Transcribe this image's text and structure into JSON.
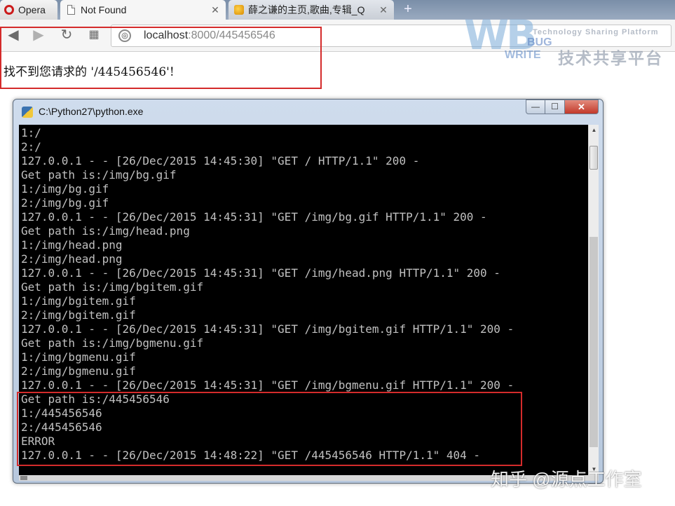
{
  "browser": {
    "tabs": [
      {
        "label": "Opera"
      },
      {
        "label": "Not Found",
        "close": "✕"
      },
      {
        "label": "薛之谦的主页,歌曲,专辑_Q",
        "close": "✕"
      }
    ],
    "new_tab": "+",
    "toolbar": {
      "back": "◀",
      "forward": "▶",
      "reload": "↻",
      "speed_dial": "▦"
    },
    "address": {
      "host": "localhost",
      "rest": ":8000/445456546",
      "site_icon": "globe-icon"
    }
  },
  "page": {
    "message": "找不到您请求的 '/445456546'!"
  },
  "watermark": {
    "logo": "WB",
    "bug": "BUG",
    "write": "WRITE",
    "subtitle": "Technology Sharing Platform",
    "chinese": "技术共享平台"
  },
  "console": {
    "title": "C:\\Python27\\python.exe",
    "controls": {
      "minimize": "—",
      "maximize": "☐",
      "close": "✕"
    },
    "lines": [
      "1:/",
      "2:/",
      "127.0.0.1 - - [26/Dec/2015 14:45:30] \"GET / HTTP/1.1\" 200 -",
      "Get path is:/img/bg.gif",
      "1:/img/bg.gif",
      "2:/img/bg.gif",
      "127.0.0.1 - - [26/Dec/2015 14:45:31] \"GET /img/bg.gif HTTP/1.1\" 200 -",
      "Get path is:/img/head.png",
      "1:/img/head.png",
      "2:/img/head.png",
      "127.0.0.1 - - [26/Dec/2015 14:45:31] \"GET /img/head.png HTTP/1.1\" 200 -",
      "Get path is:/img/bgitem.gif",
      "1:/img/bgitem.gif",
      "2:/img/bgitem.gif",
      "127.0.0.1 - - [26/Dec/2015 14:45:31] \"GET /img/bgitem.gif HTTP/1.1\" 200 -",
      "Get path is:/img/bgmenu.gif",
      "1:/img/bgmenu.gif",
      "2:/img/bgmenu.gif",
      "127.0.0.1 - - [26/Dec/2015 14:45:31] \"GET /img/bgmenu.gif HTTP/1.1\" 200 -",
      "Get path is:/445456546",
      "1:/445456546",
      "2:/445456546",
      "ERROR",
      "127.0.0.1 - - [26/Dec/2015 14:48:22] \"GET /445456546 HTTP/1.1\" 404 -"
    ]
  },
  "footer_watermark": "知乎 @源点工作室",
  "colors": {
    "highlight": "#d42b2b",
    "console_bg": "#000000",
    "console_text": "#c0c0c0"
  }
}
